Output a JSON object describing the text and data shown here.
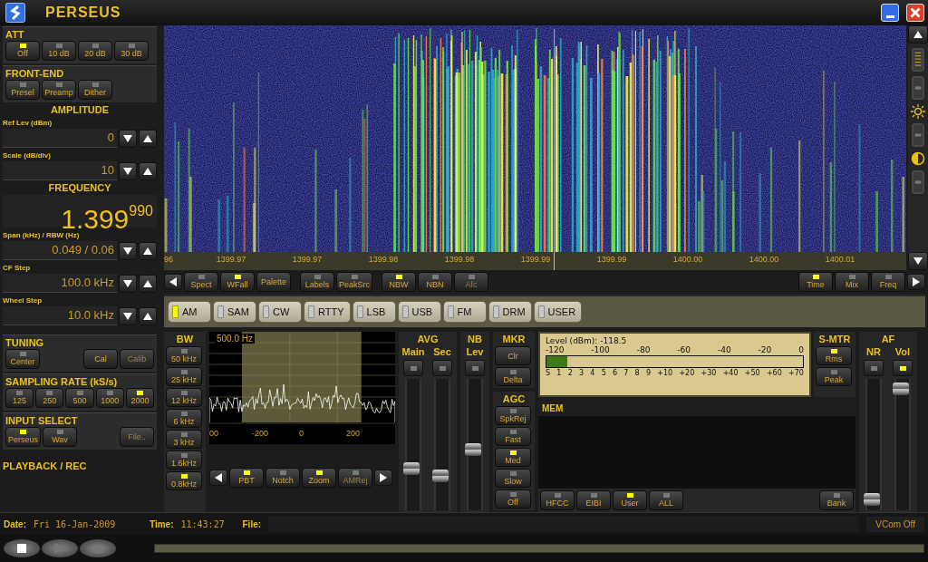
{
  "window": {
    "title": "PERSEUS"
  },
  "att": {
    "title": "ATT",
    "buttons": [
      {
        "label": "Off",
        "on": true
      },
      {
        "label": "10 dB",
        "on": false
      },
      {
        "label": "20 dB",
        "on": false
      },
      {
        "label": "30 dB",
        "on": false
      }
    ]
  },
  "front_end": {
    "title": "FRONT-END",
    "buttons": [
      {
        "label": "Presel",
        "on": false
      },
      {
        "label": "Preamp",
        "on": false
      },
      {
        "label": "Dither",
        "on": false
      }
    ]
  },
  "amplitude": {
    "title": "AMPLITUDE",
    "fields": [
      {
        "label": "Ref Lev (dBm)",
        "value": "0"
      },
      {
        "label": "Scale (dB/div)",
        "value": "10"
      }
    ]
  },
  "frequency": {
    "title": "FREQUENCY",
    "display": "1.399$^{990}$",
    "fields": [
      {
        "label": "Span (kHz) / RBW (Hz)",
        "value": "0.049 / 0.06"
      },
      {
        "label": "CF Step",
        "value": "100.0 kHz"
      },
      {
        "label": "Wheel Step",
        "value": "10.0 kHz"
      }
    ]
  },
  "tuning": {
    "title": "TUNING",
    "buttons": [
      {
        "label": "Center",
        "on": false,
        "disabled": false
      },
      {
        "label": "Cal",
        "disabled": false
      },
      {
        "label": "Calib",
        "disabled": true
      }
    ]
  },
  "sampling_rate": {
    "title": "SAMPLING RATE (kS/s)",
    "buttons": [
      {
        "label": "125",
        "on": false
      },
      {
        "label": "250",
        "on": false
      },
      {
        "label": "500",
        "on": false
      },
      {
        "label": "1000",
        "on": false
      },
      {
        "label": "2000",
        "on": true
      }
    ]
  },
  "input_select": {
    "title": "INPUT SELECT",
    "buttons": [
      {
        "label": "Perseus",
        "on": true,
        "disabled": false
      },
      {
        "label": "Wav",
        "on": false,
        "disabled": false
      },
      {
        "label": "File..",
        "disabled": true
      }
    ]
  },
  "playback": {
    "title": "PLAYBACK / REC"
  },
  "waterfall": {
    "axis_labels": [
      "96",
      "1399.97",
      "1399.97",
      "1399.98",
      "1399.98",
      "1399.99",
      "1399.99",
      "1400.00",
      "1400.00",
      "1400.01"
    ]
  },
  "toolbar": {
    "left_buttons": [
      {
        "label": "Spect",
        "on": false,
        "disabled": false
      },
      {
        "label": "WFall",
        "on": true,
        "disabled": false
      },
      {
        "label": "Palette",
        "disabled": false
      },
      {
        "label": "Labels",
        "on": false,
        "disabled": false
      },
      {
        "label": "PeakSrc",
        "on": false,
        "disabled": false
      },
      {
        "label": "NBW",
        "on": true,
        "disabled": false
      },
      {
        "label": "NBN",
        "on": false,
        "disabled": false
      },
      {
        "label": "Afc",
        "on": false,
        "disabled": true
      }
    ],
    "right_buttons": [
      {
        "label": "Time",
        "on": true
      },
      {
        "label": "Mix",
        "on": false
      },
      {
        "label": "Freq",
        "on": false
      }
    ]
  },
  "modes": [
    {
      "label": "AM",
      "selected": true
    },
    {
      "label": "SAM",
      "selected": false
    },
    {
      "label": "CW",
      "selected": false
    },
    {
      "label": "RTTY",
      "selected": false
    },
    {
      "label": "LSB",
      "selected": false
    },
    {
      "label": "USB",
      "selected": false
    },
    {
      "label": "FM",
      "selected": false
    },
    {
      "label": "DRM",
      "selected": false
    },
    {
      "label": "USER",
      "selected": false
    }
  ],
  "bw": {
    "title": "BW",
    "buttons": [
      {
        "label": "50 kHz",
        "on": false
      },
      {
        "label": "25 kHz",
        "on": false
      },
      {
        "label": "12 kHz",
        "on": false
      },
      {
        "label": "6 kHz",
        "on": false
      },
      {
        "label": "3 kHz",
        "on": false
      },
      {
        "label": "1.6kHz",
        "on": false
      },
      {
        "label": "0.8kHz",
        "on": true
      }
    ]
  },
  "filter_view": {
    "bandwidth": "500.0 Hz",
    "axis_labels": [
      "00",
      "-200",
      "0",
      "200"
    ],
    "buttons": [
      {
        "label": "PBT",
        "on": true,
        "disabled": false
      },
      {
        "label": "Notch",
        "on": false,
        "disabled": false
      },
      {
        "label": "Zoom",
        "on": true,
        "disabled": false
      },
      {
        "label": "AMRej",
        "on": false,
        "disabled": true
      }
    ]
  },
  "avg": {
    "title": "AVG",
    "sliders": [
      {
        "label": "Main",
        "on": false,
        "level": 0.3
      },
      {
        "label": "Sec",
        "on": false,
        "level": 0.24
      }
    ]
  },
  "nb": {
    "title": "NB",
    "sliders": [
      {
        "label": "Lev",
        "on": false,
        "level": 0.46
      }
    ]
  },
  "mkr": {
    "title": "MKR",
    "buttons": [
      {
        "label": "Clr"
      },
      {
        "label": "Delta",
        "on": false
      }
    ]
  },
  "agc": {
    "title": "AGC",
    "buttons": [
      {
        "label": "SpkRej",
        "on": false
      },
      {
        "label": "Fast",
        "on": false
      },
      {
        "label": "Med",
        "on": true
      },
      {
        "label": "Slow",
        "on": false
      },
      {
        "label": "Off",
        "on": false
      }
    ]
  },
  "s_meter": {
    "reading": "Level (dBm): -118.5",
    "dbm_scale": [
      "-120",
      "-100",
      "-80",
      "-60",
      "-40",
      "-20",
      "0"
    ],
    "s_scale": [
      "S",
      "1",
      "2",
      "3",
      "4",
      "5",
      "6",
      "7",
      "8",
      "9",
      "+10",
      "+20",
      "+30",
      "+40",
      "+50",
      "+60",
      "+70"
    ],
    "level": 0.08
  },
  "s_mtr": {
    "title": "S-MTR",
    "buttons": [
      {
        "label": "Rms",
        "on": true
      },
      {
        "label": "Peak",
        "on": false
      }
    ]
  },
  "mem": {
    "title": "MEM",
    "buttons": [
      {
        "label": "HFCC",
        "on": false
      },
      {
        "label": "EIBI",
        "on": false
      },
      {
        "label": "User",
        "on": true
      },
      {
        "label": "ALL",
        "on": false
      }
    ],
    "bank": {
      "label": "Bank",
      "on": false
    }
  },
  "af": {
    "title": "AF",
    "sliders": [
      {
        "label": "NR",
        "on": false,
        "level": 0.04
      },
      {
        "label": "Vol",
        "on": true,
        "level": 0.97
      }
    ]
  },
  "status_bar": {
    "date_label": "Date:",
    "date": "Fri 16-Jan-2009",
    "time_label": "Time:",
    "time": "11:43:27",
    "file_label": "File:",
    "vcom": "VCom Off"
  }
}
